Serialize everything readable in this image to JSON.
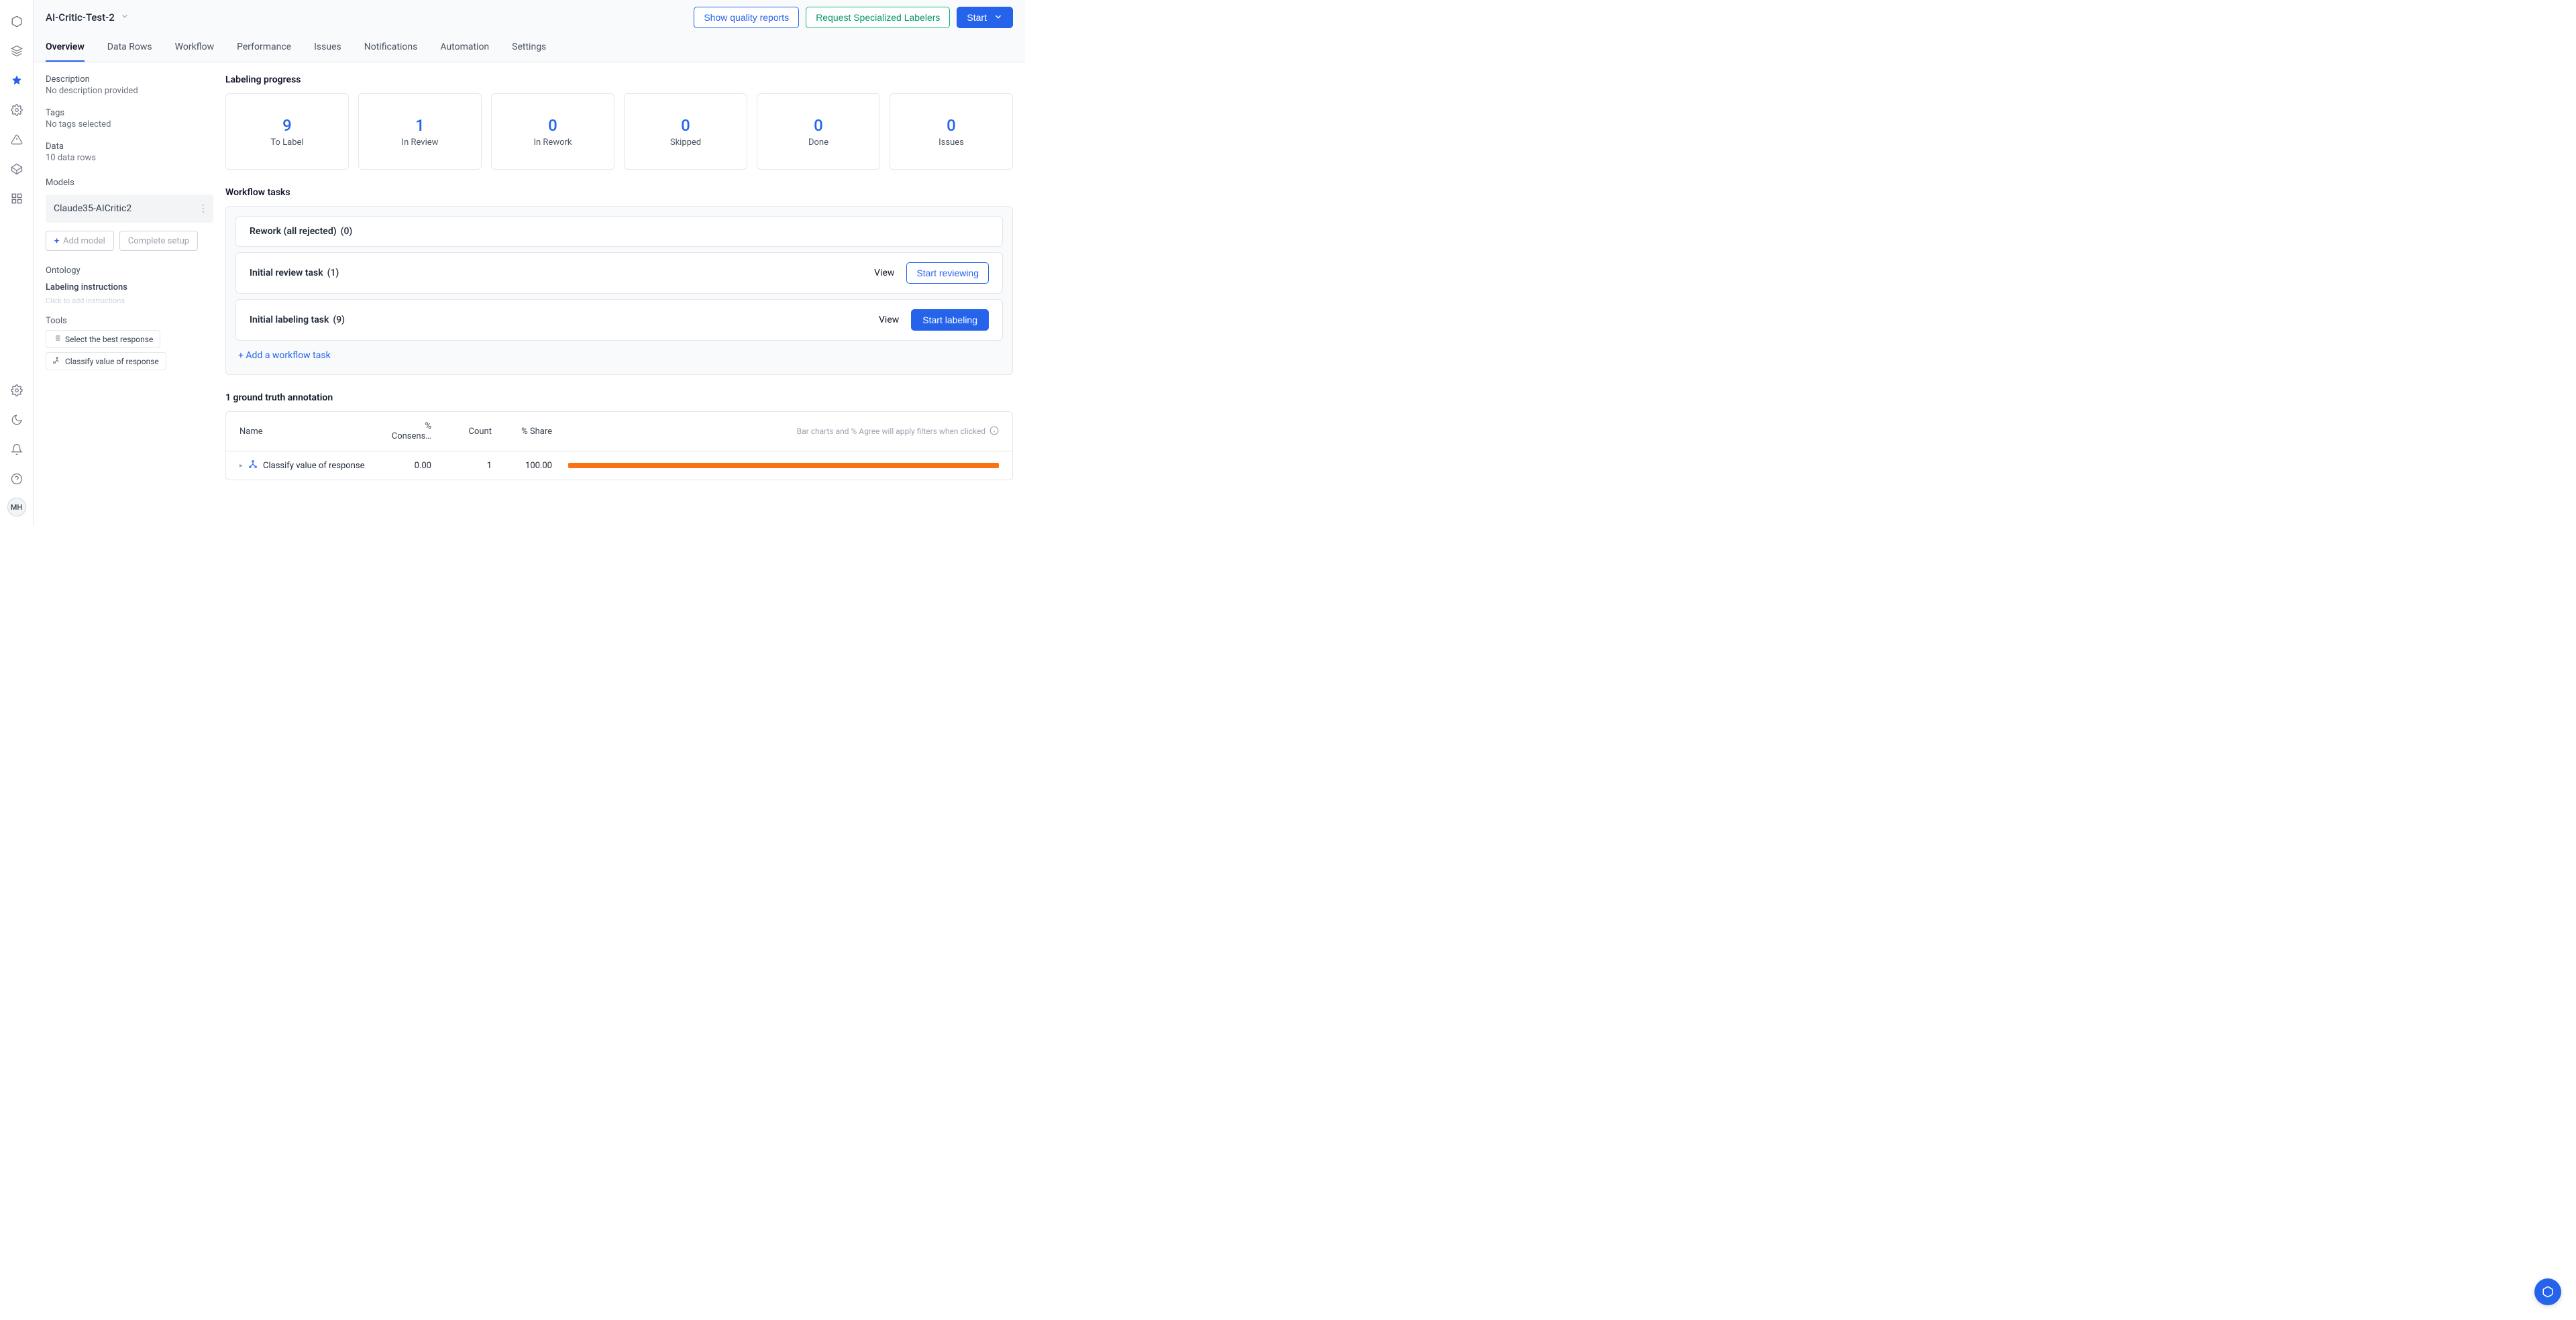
{
  "project_title": "AI-Critic-Test-2",
  "header_buttons": {
    "quality_reports": "Show quality reports",
    "specialized_labelers": "Request Specialized Labelers",
    "start": "Start"
  },
  "tabs": [
    "Overview",
    "Data Rows",
    "Workflow",
    "Performance",
    "Issues",
    "Notifications",
    "Automation",
    "Settings"
  ],
  "sidebar": {
    "description_label": "Description",
    "description_value": "No description provided",
    "tags_label": "Tags",
    "tags_value": "No tags selected",
    "data_label": "Data",
    "data_value": "10 data rows",
    "models_label": "Models",
    "model_name": "Claude35-AICritic2",
    "add_model": "Add model",
    "complete_setup": "Complete setup",
    "ontology_label": "Ontology",
    "labeling_instructions_label": "Labeling instructions",
    "labeling_instructions_hint": "Click to add instructions",
    "tools_label": "Tools",
    "tools": [
      "Select the best response",
      "Classify value of response"
    ]
  },
  "pane": {
    "labeling_progress_heading": "Labeling progress",
    "stats": [
      {
        "value": "9",
        "label": "To Label"
      },
      {
        "value": "1",
        "label": "In Review"
      },
      {
        "value": "0",
        "label": "In Rework"
      },
      {
        "value": "0",
        "label": "Skipped"
      },
      {
        "value": "0",
        "label": "Done"
      },
      {
        "value": "0",
        "label": "Issues"
      }
    ],
    "workflow_heading": "Workflow tasks",
    "wf_rows": [
      {
        "title": "Rework (all rejected)",
        "count": "(0)"
      },
      {
        "title": "Initial review task",
        "count": "(1)",
        "view": "View",
        "action": "Start reviewing",
        "action_primary": false
      },
      {
        "title": "Initial labeling task",
        "count": "(9)",
        "view": "View",
        "action": "Start labeling",
        "action_primary": true
      }
    ],
    "add_workflow_task": "+ Add a workflow task",
    "ground_truth_heading": "1 ground truth annotation",
    "gt_columns": {
      "name": "Name",
      "consensus": "% Consens…",
      "count": "Count",
      "share": "% Share",
      "hint": "Bar charts and % Agree will apply filters when clicked"
    },
    "gt_row": {
      "name": "Classify value of response",
      "consensus": "0.00",
      "count": "1",
      "share": "100.00"
    }
  },
  "avatar_initials": "MH"
}
